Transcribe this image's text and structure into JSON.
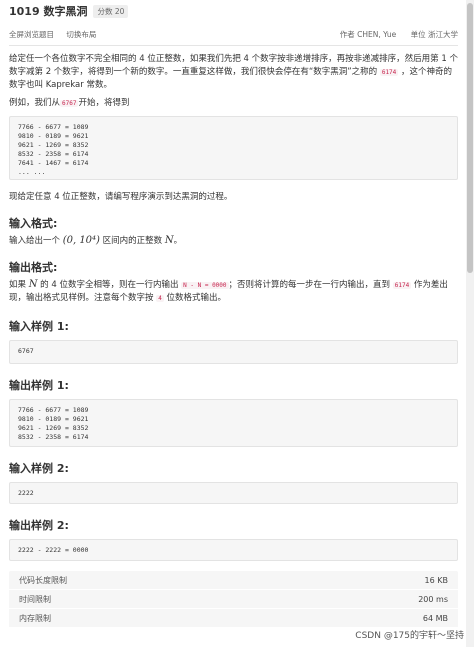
{
  "problem": {
    "title": "1019 数字黑洞",
    "score": "分数 20",
    "actions": {
      "fullscreen": "全屏浏览题目",
      "switch_layout": "切换布局"
    },
    "author": "作者 CHEN, Yue",
    "unit": "单位 浙江大学"
  },
  "content": {
    "intro_1": "给定任一个各位数字不完全相同的 4 位正整数，如果我们先把 4 个数字按非递增排序，再按非递减排序，然后用第 1 个数字减第 2 个数字，将得到一个新的数字。一直重复这样做，我们很快会停在有“数字黑洞”之称的 ",
    "intro_code": "6174",
    "intro_2": " ，这个神奇的数字也叫 Kaprekar 常数。",
    "example_1": "例如，我们从",
    "example_code": "6767",
    "example_2": "开始，将得到",
    "example_block": "7766 - 6677 = 1089\n9810 - 0189 = 9621\n9621 - 1269 = 8352\n8532 - 2358 = 6174\n7641 - 1467 = 6174\n... ...",
    "task": "现给定任意 4 位正整数，请编写程序演示到达黑洞的过程。",
    "input_heading": "输入格式:",
    "input_1": "输入给出一个 ",
    "input_math": "(0, 10⁴)",
    "input_2": " 区间内的正整数 ",
    "input_var": "N",
    "input_3": "。",
    "output_heading": "输出格式:",
    "output_1": "如果 ",
    "output_var": "N",
    "output_2": " 的 4 位数字全相等，则在一行内输出 ",
    "output_code_1": "N - N = 0000",
    "output_3": "；否则将计算的每一步在一行内输出，直到 ",
    "output_code_2": "6174",
    "output_4": " 作为差出现，输出格式见样例。注意每个数字按 ",
    "output_code_3": "4",
    "output_5": " 位数格式输出。",
    "sample_in_1_heading": "输入样例 1:",
    "sample_in_1": "6767",
    "sample_out_1_heading": "输出样例 1:",
    "sample_out_1": "7766 - 6677 = 1089\n9810 - 0189 = 9621\n9621 - 1269 = 8352\n8532 - 2358 = 6174",
    "sample_in_2_heading": "输入样例 2:",
    "sample_in_2": "2222",
    "sample_out_2_heading": "输出样例 2:",
    "sample_out_2": "2222 - 2222 = 0000"
  },
  "limits": [
    {
      "label": "代码长度限制",
      "value": "16 KB"
    },
    {
      "label": "时间限制",
      "value": "200 ms"
    },
    {
      "label": "内存限制",
      "value": "64 MB"
    }
  ],
  "watermark": "CSDN @175的宇轩～坚持"
}
